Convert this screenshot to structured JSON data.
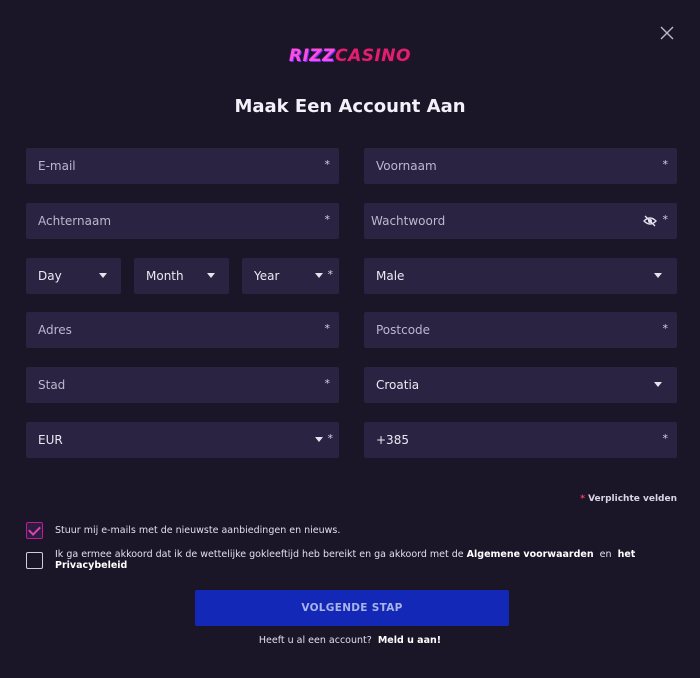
{
  "logo": {
    "part1": "RIZZ",
    "part2": "CASINO"
  },
  "title": "Maak Een Account Aan",
  "required_star": "*",
  "fields": {
    "email": "E-mail",
    "firstname": "Voornaam",
    "lastname": "Achternaam",
    "password": "Wachtwoord",
    "day": "Day",
    "month": "Month",
    "year": "Year",
    "gender": "Male",
    "address": "Adres",
    "postcode": "Postcode",
    "city": "Stad",
    "country": "Croatia",
    "currency": "EUR",
    "phone_prefix": "+385"
  },
  "required_note": "Verplichte velden",
  "newsletter": {
    "checked": true,
    "label": "Stuur mij e-mails met de nieuwste aanbiedingen en nieuws."
  },
  "terms": {
    "checked": false,
    "text_before": "Ik ga ermee akkoord dat ik de wettelijke gokleeftijd heb bereikt en ga akkoord met de ",
    "terms_link": "Algemene voorwaarden",
    "text_mid": "en",
    "privacy_link": "het Privacybeleid"
  },
  "next_button": "VOLGENDE STAP",
  "login": {
    "question": "Heeft u al een account?",
    "link": "Meld u aan!"
  }
}
